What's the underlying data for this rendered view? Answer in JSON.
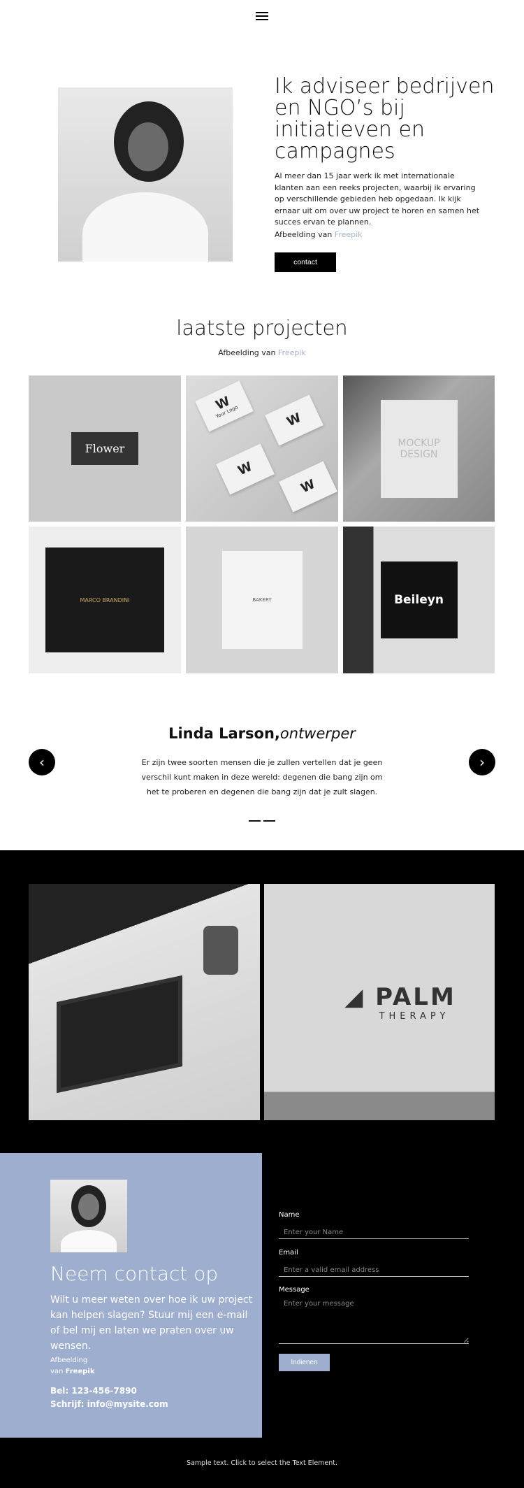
{
  "nav": {
    "menu_icon": "hamburger-icon"
  },
  "hero": {
    "title": "Ik adviseer bedrijven en NGO’s bij initiatieven en campagnes",
    "text": "Al meer dan 15 jaar werk ik met internationale klanten aan een reeks projecten, waarbij ik ervaring op verschillende gebieden heb opgedaan. Ik kijk ernaar uit om over uw project te horen en samen het succes ervan te plannen.",
    "credit_prefix": "Afbeelding van ",
    "credit_link": "Freepik",
    "button": "contact"
  },
  "projects": {
    "title": "laatste projecten",
    "credit_prefix": "Afbeelding van ",
    "credit_link": "Freepik",
    "images": [
      "Flower",
      "Your Logo",
      "MOCKUP DESIGN",
      "MARCO BRANDINI",
      "BAKERY",
      "Beileyn"
    ]
  },
  "testimonial": {
    "name": "Linda Larson,",
    "role": "ontwerper",
    "quote": "Er zijn twee soorten mensen die je zullen vertellen dat je geen verschil kunt maken in deze wereld: degenen die bang zijn om het te proberen en degenen die bang zijn dat je zult slagen.",
    "prev_icon": "chevron-left-icon",
    "next_icon": "chevron-right-icon"
  },
  "gallery": {
    "logo_text": "PALM",
    "logo_sub": "THERAPY"
  },
  "contact": {
    "title": "Neem contact op",
    "text": "Wilt u meer weten over hoe ik uw project kan helpen slagen? Stuur mij een e-mail of bel mij en laten we praten over uw wensen.",
    "credit_line1": "Afbeelding",
    "credit_prefix": "van ",
    "credit_link": "Freepik",
    "phone": "Bel: 123-456-7890",
    "email": "Schrijf: info@mysite.com",
    "bg_color": "#9eaecf"
  },
  "form": {
    "name_label": "Name",
    "name_placeholder": "Enter your Name",
    "email_label": "Email",
    "email_placeholder": "Enter a valid email address",
    "message_label": "Message",
    "message_placeholder": "Enter your message",
    "submit": "Indienen"
  },
  "footer": {
    "text": "Sample text. Click to select the Text Element."
  }
}
